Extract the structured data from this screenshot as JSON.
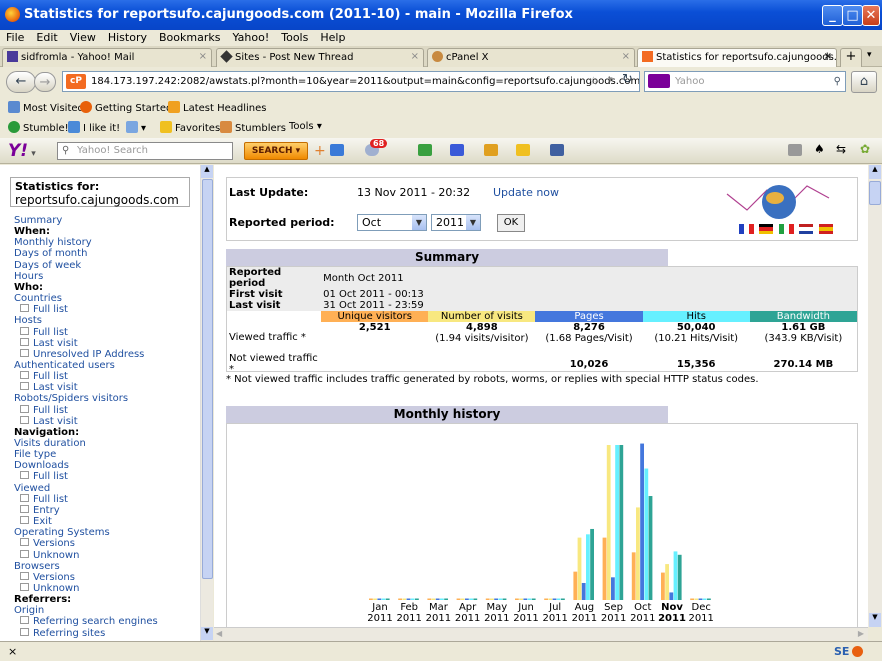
{
  "window": {
    "title": "Statistics for reportsufo.cajungoods.com (2011-10) - main - Mozilla Firefox"
  },
  "menu": [
    "File",
    "Edit",
    "View",
    "History",
    "Bookmarks",
    "Yahoo!",
    "Tools",
    "Help"
  ],
  "tabs": [
    {
      "label": "sidfromla - Yahoo! Mail"
    },
    {
      "label": "Sites - Post New Thread"
    },
    {
      "label": "cPanel X"
    },
    {
      "label": "Statistics for reportsufo.cajungoods.co..."
    }
  ],
  "nav": {
    "url": "184.173.197.242:2082/awstats.pl?month=10&year=2011&output=main&config=reportsufo.cajungoods.com&lang=en",
    "search_placeholder": "Yahoo"
  },
  "bookmarks": {
    "most_visited": "Most Visited",
    "getting_started": "Getting Started",
    "latest_headlines": "Latest Headlines",
    "stumble": "Stumble!",
    "ilikeit": "I like it!",
    "favorites": "Favorites",
    "stumblers": "Stumblers",
    "tools": "Tools"
  },
  "ytoolbar": {
    "search_placeholder": "Yahoo! Search",
    "search_btn": "SEARCH",
    "mail_count": "68"
  },
  "sidebar": {
    "stats_for": "Statistics for:",
    "domain": "reportsufo.cajungoods.com",
    "items": [
      {
        "t": "Summary",
        "k": "link"
      },
      {
        "t": "When:",
        "k": "head"
      },
      {
        "t": "Monthly history",
        "k": "link"
      },
      {
        "t": "Days of month",
        "k": "link"
      },
      {
        "t": "Days of week",
        "k": "link"
      },
      {
        "t": "Hours",
        "k": "link"
      },
      {
        "t": "Who:",
        "k": "head"
      },
      {
        "t": "Countries",
        "k": "link"
      },
      {
        "t": "Full list",
        "k": "sub"
      },
      {
        "t": "Hosts",
        "k": "link"
      },
      {
        "t": "Full list",
        "k": "sub"
      },
      {
        "t": "Last visit",
        "k": "sub"
      },
      {
        "t": "Unresolved IP Address",
        "k": "sub"
      },
      {
        "t": "Authenticated users",
        "k": "link"
      },
      {
        "t": "Full list",
        "k": "sub"
      },
      {
        "t": "Last visit",
        "k": "sub"
      },
      {
        "t": "Robots/Spiders visitors",
        "k": "link"
      },
      {
        "t": "Full list",
        "k": "sub"
      },
      {
        "t": "Last visit",
        "k": "sub"
      },
      {
        "t": "Navigation:",
        "k": "head"
      },
      {
        "t": "Visits duration",
        "k": "link"
      },
      {
        "t": "File type",
        "k": "link"
      },
      {
        "t": "Downloads",
        "k": "link"
      },
      {
        "t": "Full list",
        "k": "sub"
      },
      {
        "t": "Viewed",
        "k": "link"
      },
      {
        "t": "Full list",
        "k": "sub"
      },
      {
        "t": "Entry",
        "k": "sub"
      },
      {
        "t": "Exit",
        "k": "sub"
      },
      {
        "t": "Operating Systems",
        "k": "link"
      },
      {
        "t": "Versions",
        "k": "sub"
      },
      {
        "t": "Unknown",
        "k": "sub"
      },
      {
        "t": "Browsers",
        "k": "link"
      },
      {
        "t": "Versions",
        "k": "sub"
      },
      {
        "t": "Unknown",
        "k": "sub"
      },
      {
        "t": "Referrers:",
        "k": "head"
      },
      {
        "t": "Origin",
        "k": "link"
      },
      {
        "t": "Referring search engines",
        "k": "sub"
      },
      {
        "t": "Referring sites",
        "k": "sub"
      }
    ]
  },
  "update": {
    "last_update_label": "Last Update:",
    "last_update_value": "13 Nov 2011 - 20:32",
    "update_now": "Update now",
    "period_label": "Reported period:",
    "month": "Oct",
    "year": "2011",
    "ok": "OK"
  },
  "summary": {
    "title": "Summary",
    "reported_period_label": "Reported period",
    "reported_period": "Month Oct 2011",
    "first_visit_label": "First visit",
    "first_visit": "01 Oct 2011 - 00:13",
    "last_visit_label": "Last visit",
    "last_visit": "31 Oct 2011 - 23:59",
    "columns": [
      "Unique visitors",
      "Number of visits",
      "Pages",
      "Hits",
      "Bandwidth"
    ],
    "column_colors": [
      "#ffb055",
      "#f8e880",
      "#4477dd",
      "#66f0ff",
      "#2ea495"
    ],
    "viewed_label": "Viewed traffic *",
    "viewed": {
      "uv": "2,521",
      "visits": "4,898",
      "visits_sub": "(1.94 visits/visitor)",
      "pages": "8,276",
      "pages_sub": "(1.68 Pages/Visit)",
      "hits": "50,040",
      "hits_sub": "(10.21 Hits/Visit)",
      "bw": "1.61 GB",
      "bw_sub": "(343.9 KB/Visit)"
    },
    "notviewed_label": "Not viewed traffic *",
    "notviewed": {
      "pages": "10,026",
      "hits": "15,356",
      "bw": "270.14 MB"
    },
    "note": "* Not viewed traffic includes traffic generated by robots, worms, or replies with special HTTP status codes."
  },
  "monthly": {
    "title": "Monthly history",
    "months": [
      "Jan",
      "Feb",
      "Mar",
      "Apr",
      "May",
      "Jun",
      "Jul",
      "Aug",
      "Sep",
      "Oct",
      "Nov",
      "Dec"
    ],
    "year": "2011"
  },
  "chart_data": {
    "type": "bar",
    "categories": [
      "Jan 2011",
      "Feb 2011",
      "Mar 2011",
      "Apr 2011",
      "May 2011",
      "Jun 2011",
      "Jul 2011",
      "Aug 2011",
      "Sep 2011",
      "Oct 2011",
      "Nov 2011",
      "Dec 2011"
    ],
    "series": [
      {
        "name": "Unique visitors",
        "values": [
          0,
          0,
          0,
          0,
          0,
          0,
          0,
          1500,
          3300,
          2521,
          1450,
          0
        ]
      },
      {
        "name": "Number of visits",
        "values": [
          0,
          0,
          0,
          0,
          0,
          0,
          0,
          3300,
          8200,
          4898,
          1900,
          0
        ]
      },
      {
        "name": "Pages",
        "values": [
          0,
          0,
          0,
          0,
          0,
          0,
          0,
          900,
          1200,
          8276,
          400,
          0
        ]
      },
      {
        "name": "Hits",
        "values": [
          0,
          0,
          0,
          0,
          0,
          0,
          0,
          25000,
          59000,
          50040,
          18500,
          0
        ]
      },
      {
        "name": "Bandwidth",
        "values": [
          0,
          0,
          0,
          0,
          0,
          0,
          0,
          1.1,
          2.4,
          1.61,
          0.7,
          0
        ]
      }
    ],
    "highlight": "Nov 2011"
  },
  "status": {
    "left": "×",
    "right": "SE"
  }
}
